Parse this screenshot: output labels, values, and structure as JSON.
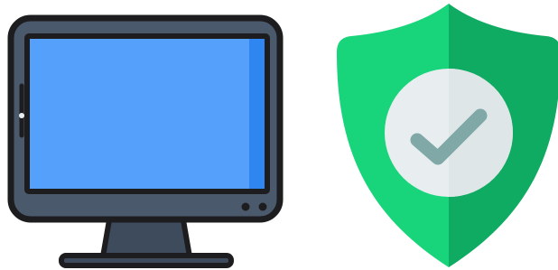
{
  "illustration": {
    "left_icon": "monitor-icon",
    "right_icon": "security-shield-check-icon"
  },
  "colors": {
    "outline": "#1d1d1f",
    "monitor_bezel": "#4a596b",
    "monitor_screen": "#55a0fa",
    "monitor_screen_edge": "#2f86f0",
    "monitor_stand": "#3d4b5c",
    "shield_left": "#18d47a",
    "shield_right": "#0fab62",
    "badge": "#e8eef0",
    "checkmark": "#7fa8a6"
  }
}
